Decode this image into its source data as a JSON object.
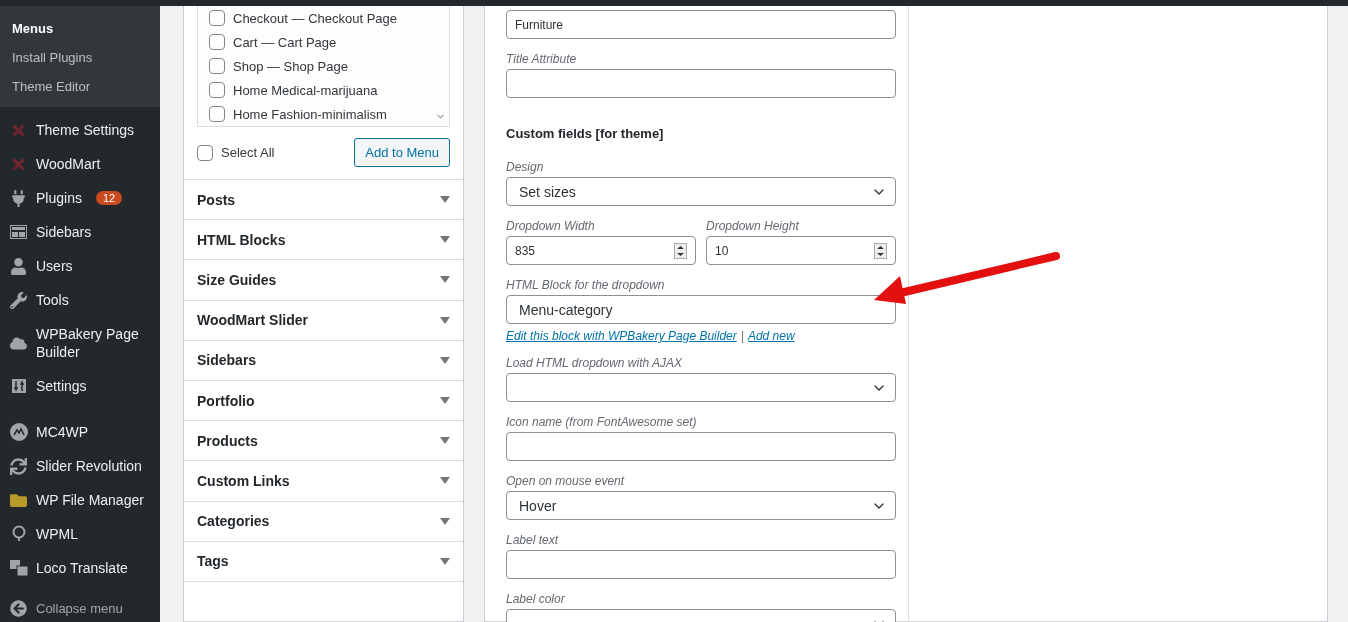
{
  "admin_menu": {
    "submenu": [
      {
        "label": "Menus",
        "selected": true
      },
      {
        "label": "Install Plugins",
        "selected": false
      },
      {
        "label": "Theme Editor",
        "selected": false
      }
    ],
    "groups": [
      [
        {
          "label": "Theme Settings"
        },
        {
          "label": "WoodMart"
        },
        {
          "label": "Plugins",
          "badge": "12"
        },
        {
          "label": "Sidebars"
        },
        {
          "label": "Users"
        },
        {
          "label": "Tools"
        },
        {
          "label": "WPBakery Page Builder"
        },
        {
          "label": "Settings"
        }
      ],
      [
        {
          "label": "MC4WP"
        },
        {
          "label": "Slider Revolution"
        },
        {
          "label": "WP File Manager"
        },
        {
          "label": "WPML"
        },
        {
          "label": "Loco Translate"
        }
      ]
    ],
    "collapse": "Collapse menu"
  },
  "add_items": {
    "pages": [
      {
        "label": "Checkout — Checkout Page",
        "checked": false
      },
      {
        "label": "Cart — Cart Page",
        "checked": false
      },
      {
        "label": "Shop — Shop Page",
        "checked": false
      },
      {
        "label": "Home Medical-marijuana",
        "checked": false
      },
      {
        "label": "Home Fashion-minimalism",
        "checked": false
      }
    ],
    "select_all": {
      "label": "Select All",
      "checked": false
    },
    "add_button": "Add to Menu",
    "sections": [
      "Posts",
      "HTML Blocks",
      "Size Guides",
      "WoodMart Slider",
      "Sidebars",
      "Portfolio",
      "Products",
      "Custom Links",
      "Categories",
      "Tags"
    ]
  },
  "menu_item": {
    "fields": [
      {
        "kind": "text",
        "value": "Furniture"
      },
      {
        "kind": "text",
        "label": "Title Attribute"
      },
      {
        "kind": "heading",
        "label": "Custom fields [for theme]"
      },
      {
        "kind": "select",
        "label": "Design",
        "value": "Set sizes"
      },
      {
        "kind": "pair",
        "fields": [
          {
            "label": "Dropdown Width",
            "value": "835"
          },
          {
            "label": "Dropdown Height",
            "value": "10"
          }
        ]
      },
      {
        "kind": "choice",
        "label": "HTML Block for the dropdown",
        "value": "Menu-category"
      },
      {
        "kind": "links",
        "links": [
          "Edit this block with WPBakery Page Builder",
          "Add new"
        ],
        "separator": "|"
      },
      {
        "kind": "select",
        "label": "Load HTML dropdown with AJAX"
      },
      {
        "kind": "text",
        "label": "Icon name (from FontAwesome set)"
      },
      {
        "kind": "select",
        "label": "Open on mouse event",
        "value": "Hover"
      },
      {
        "kind": "text",
        "label": "Label text"
      },
      {
        "kind": "select",
        "label": "Label color"
      }
    ]
  }
}
